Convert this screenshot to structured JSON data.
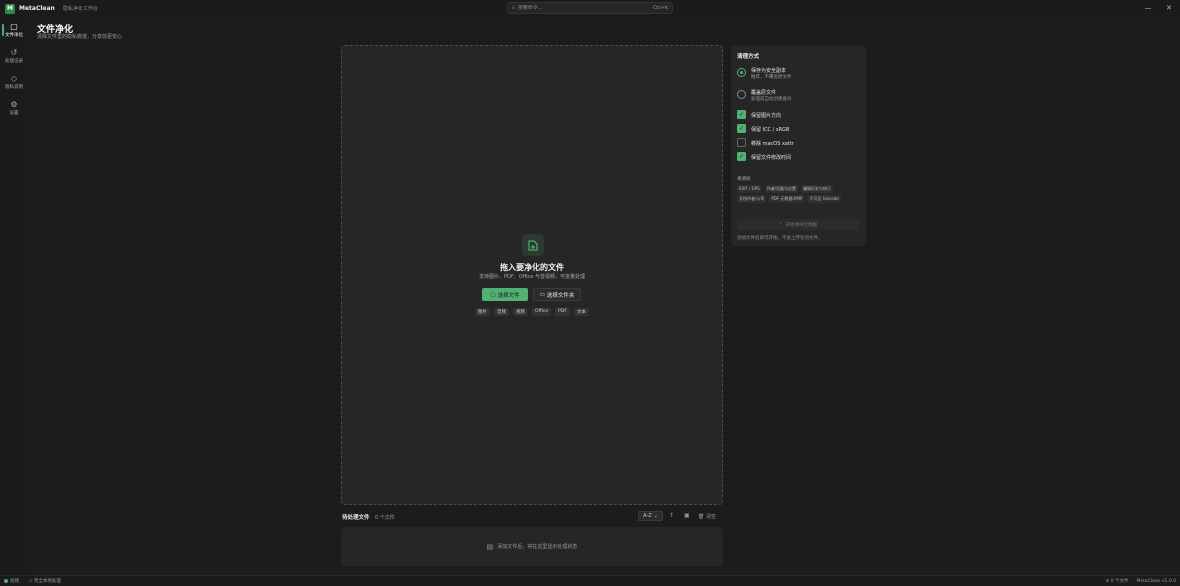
{
  "app": {
    "logo_letter": "M",
    "name": "MetaClean",
    "subtitle": "隐私净化工作台"
  },
  "search": {
    "placeholder": "搜索命令...",
    "shortcut": "Ctrl+K"
  },
  "window_controls": {
    "minimize": "—",
    "close": "✕"
  },
  "sidebar": {
    "items": [
      {
        "label": "文件净化",
        "icon": "file-icon",
        "glyph": "▢",
        "active": true
      },
      {
        "label": "处理记录",
        "icon": "history-icon",
        "glyph": "↺",
        "active": false
      },
      {
        "label": "隐私说明",
        "icon": "shield-icon",
        "glyph": "◇",
        "active": false
      },
      {
        "label": "设置",
        "icon": "gear-icon",
        "glyph": "⚙",
        "active": false
      }
    ]
  },
  "page": {
    "title": "文件净化",
    "subtitle": "清除文件里的隐私痕迹，分享前更安心"
  },
  "dropzone": {
    "icon": "file-add-icon",
    "title": "拖入要净化的文件",
    "subtitle": "支持图片、PDF、Office 与音视频，可批量处理",
    "select_files": "选择文件",
    "select_folder": "选择文件夹",
    "types": [
      "图片",
      "音频",
      "视频",
      "Office",
      "PDF",
      "文本"
    ]
  },
  "pending": {
    "label": "待处理文件",
    "count": "0 个文件",
    "sort": "A-Z",
    "clear": "清空",
    "empty_text": "添加文件后，将在这里显示处理状态"
  },
  "panel": {
    "title": "清理方式",
    "options": [
      {
        "label": "保存为安全副本",
        "desc": "推荐，不覆盖原文件",
        "checked": true
      },
      {
        "label": "覆盖原文件",
        "desc": "处理前自动创建备份",
        "checked": false
      }
    ],
    "checks": [
      {
        "label": "保留图片方向",
        "checked": true
      },
      {
        "label": "保留 ICC / sRGB",
        "checked": true
      },
      {
        "label": "移除 macOS xattr",
        "checked": false
      },
      {
        "label": "保留文件修改时间",
        "checked": true
      }
    ],
    "section_label": "将清除",
    "tags": [
      "EXIF / GPS",
      "作者/设备与位置",
      "编辑历史与修订",
      "文档作者/公司",
      "PDF 元数据/XMP",
      "不可见 Unicode"
    ],
    "action_button": "开始清除元数据",
    "note": "添加文件后即可开始，不会上传任何文件。"
  },
  "status": {
    "left": [
      "就绪",
      "完全本地处理"
    ],
    "right": [
      "0 个文件",
      "MetaClean v1.0.0"
    ]
  },
  "colors": {
    "accent": "#53b073",
    "background": "#1c1c1c",
    "surface": "#262626"
  }
}
